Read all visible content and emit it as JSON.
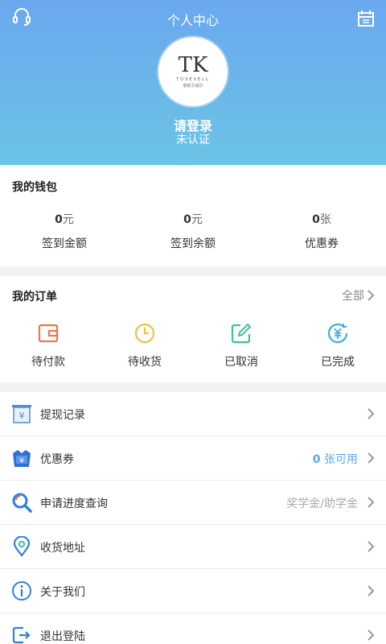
{
  "header": {
    "title": "个人中心",
    "left_icon": "headset-icon",
    "right_icon": "calendar-icon",
    "avatar": {
      "logo": "TK",
      "brand": "TOSEVELL",
      "sub": "泰斯艾威尔"
    },
    "login_text": "请登录",
    "auth_status": "未认证"
  },
  "wallet": {
    "title": "我的钱包",
    "items": [
      {
        "value": "0",
        "unit": "元",
        "label": "签到金额"
      },
      {
        "value": "0",
        "unit": "元",
        "label": "签到余额"
      },
      {
        "value": "0",
        "unit": "张",
        "label": "优惠券"
      }
    ]
  },
  "orders": {
    "title": "我的订单",
    "all_label": "全部",
    "items": [
      {
        "label": "待付款",
        "icon": "wallet-icon",
        "color": "#f0744f"
      },
      {
        "label": "待收货",
        "icon": "clock-icon",
        "color": "#f5c13a"
      },
      {
        "label": "已取消",
        "icon": "edit-icon",
        "color": "#3cc29a"
      },
      {
        "label": "已完成",
        "icon": "yen-refresh-icon",
        "color": "#3aaee0"
      }
    ]
  },
  "menu": {
    "items": [
      {
        "label": "提现记录",
        "icon": "withdraw-record-icon",
        "extra": ""
      },
      {
        "label": "优惠券",
        "icon": "coupon-icon",
        "extra_count": "0",
        "extra_unit": " 张可用"
      },
      {
        "label": "申请进度查询",
        "icon": "search-progress-icon",
        "extra": "奖学金/助学金"
      },
      {
        "label": "收货地址",
        "icon": "location-icon",
        "extra": ""
      },
      {
        "label": "关于我们",
        "icon": "info-icon",
        "extra": ""
      },
      {
        "label": "退出登陆",
        "icon": "logout-icon",
        "extra": ""
      }
    ]
  },
  "colors": {
    "header_top": "#6aa8ee",
    "header_bottom": "#6bc4e6",
    "accent_blue": "#5aa8e8"
  }
}
